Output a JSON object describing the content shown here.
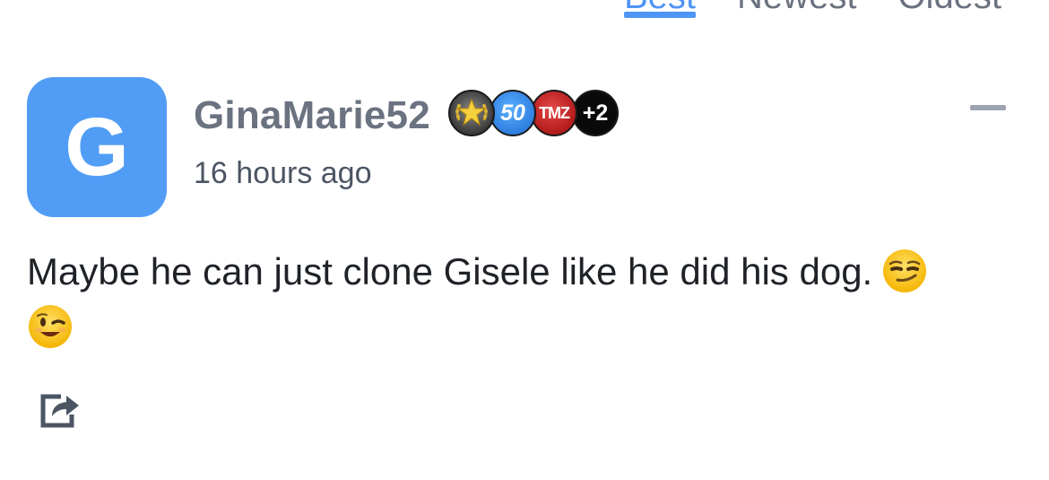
{
  "sort_tabs": [
    {
      "label": "Best",
      "active": true
    },
    {
      "label": "Newest",
      "active": false
    },
    {
      "label": "Oldest",
      "active": false
    }
  ],
  "comment": {
    "avatar_letter": "G",
    "avatar_color": "#519df6",
    "username": "GinaMarie52",
    "badges": [
      {
        "icon": "star-laurel-badge"
      },
      {
        "label": "50",
        "icon": "fifty-badge"
      },
      {
        "label": "TMZ",
        "icon": "tmz-badge"
      },
      {
        "label": "+2",
        "icon": "more-badges"
      }
    ],
    "timestamp": "16 hours ago",
    "text": "Maybe he can just clone Gisele like he did his dog.",
    "emojis": [
      "smirking-face",
      "winking-face"
    ]
  },
  "colors": {
    "accent": "#4f95f5",
    "username": "#6b7280"
  }
}
